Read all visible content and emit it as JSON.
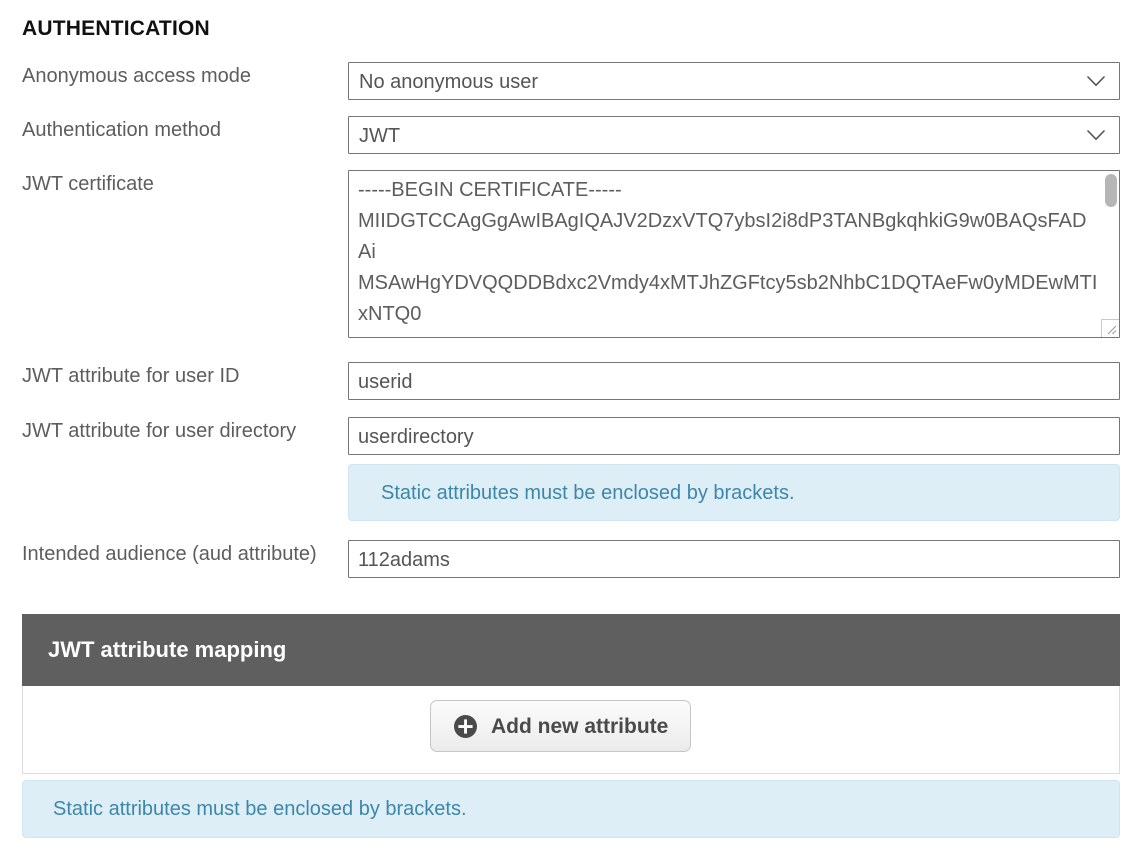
{
  "section": {
    "heading": "AUTHENTICATION"
  },
  "fields": {
    "anonymous_access": {
      "label": "Anonymous access mode",
      "value": "No anonymous user",
      "icon": "chevron-down-icon"
    },
    "auth_method": {
      "label": "Authentication method",
      "value": "JWT",
      "icon": "chevron-down-icon"
    },
    "jwt_certificate": {
      "label": "JWT certificate",
      "value": "-----BEGIN CERTIFICATE-----\nMIIDGTCCAgGgAwIBAgIQAJV2DzxVTQ7ybsI2i8dP3TANBgkqhkiG9w0BAQsFADAi\nMSAwHgYDVQQDDBdxc2Vmdy4xMTJhZGFtcy5sb2NhbC1DQTAeFw0yMDEwMTIxNTQ0"
    },
    "jwt_user_id": {
      "label": "JWT attribute for user ID",
      "value": "userid"
    },
    "jwt_user_directory": {
      "label": "JWT attribute for user directory",
      "value": "userdirectory",
      "hint": "Static attributes must be enclosed by brackets."
    },
    "intended_audience": {
      "label": "Intended audience (aud attribute)",
      "value": "112adams"
    }
  },
  "attribute_mapping": {
    "title": "JWT attribute mapping",
    "add_button_label": "Add new attribute",
    "add_button_icon": "plus-circle-icon",
    "hint": "Static attributes must be enclosed by brackets."
  },
  "colors": {
    "header_bar": "#5f5f5f",
    "info_background": "#ddeef7",
    "info_text": "#3d87a8",
    "label_text": "#5d5d5d",
    "input_border": "#767676"
  }
}
